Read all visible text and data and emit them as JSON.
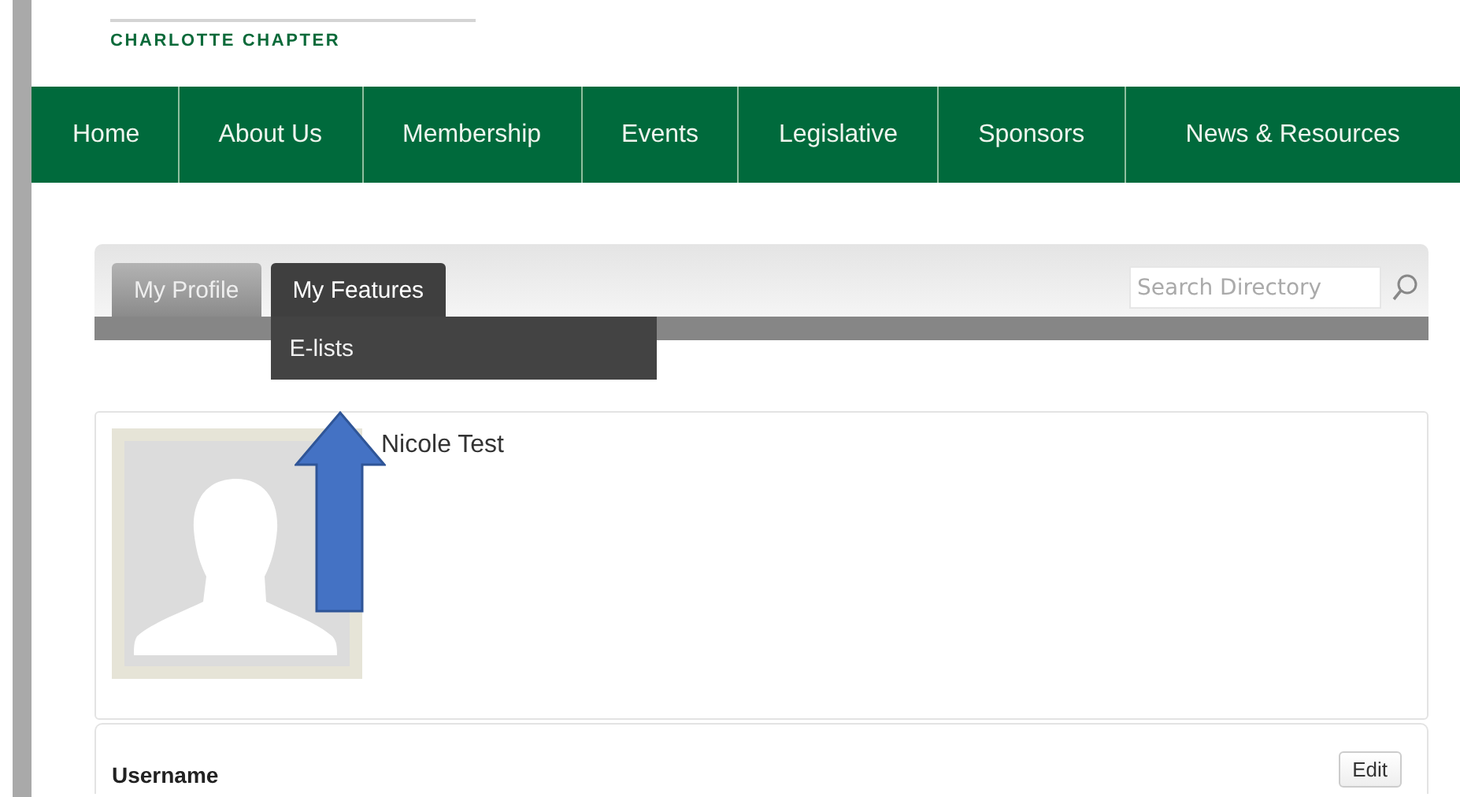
{
  "logo": {
    "subtitle": "CHARLOTTE CHAPTER"
  },
  "nav": [
    "Home",
    "About Us",
    "Membership",
    "Events",
    "Legislative",
    "Sponsors",
    "News & Resources"
  ],
  "profile_tabs": [
    {
      "label": "My Profile",
      "selected": false
    },
    {
      "label": "My Features",
      "selected": true
    }
  ],
  "dropdown": {
    "items": [
      "E-lists"
    ]
  },
  "search": {
    "placeholder": "Search Directory"
  },
  "profile": {
    "name": "Nicole Test"
  },
  "account": {
    "label": "Username",
    "button": "Edit"
  }
}
